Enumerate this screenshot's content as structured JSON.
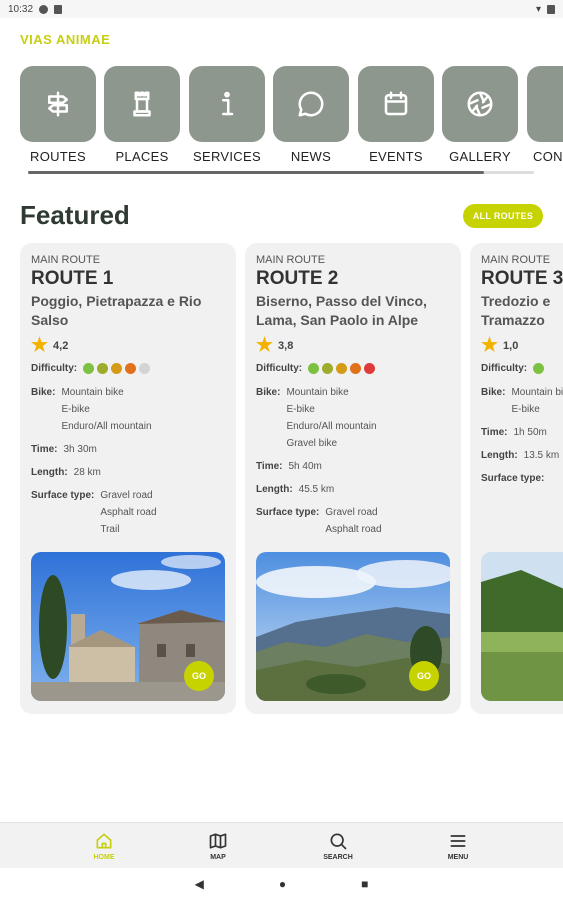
{
  "status_bar": {
    "time": "10:32"
  },
  "app": {
    "title": "VIAS ANIMAE"
  },
  "categories": [
    {
      "label": "ROUTES",
      "icon": "signpost-icon"
    },
    {
      "label": "PLACES",
      "icon": "tower-icon"
    },
    {
      "label": "SERVICES",
      "icon": "info-icon"
    },
    {
      "label": "NEWS",
      "icon": "chat-bubble-icon"
    },
    {
      "label": "EVENTS",
      "icon": "calendar-icon"
    },
    {
      "label": "GALLERY",
      "icon": "camera-aperture-icon"
    },
    {
      "label": "CON",
      "icon": "tile-icon"
    }
  ],
  "featured": {
    "heading": "Featured",
    "all_routes_label": "ALL ROUTES"
  },
  "labels": {
    "difficulty": "Difficulty:",
    "bike": "Bike:",
    "time": "Time:",
    "length": "Length:",
    "surface": "Surface type:",
    "go": "GO"
  },
  "cards": [
    {
      "kind": "MAIN ROUTE",
      "title": "ROUTE 1",
      "subtitle_lines": [
        "Poggio, Pietrapazza e Rio",
        "Salso"
      ],
      "rating": "4,2",
      "difficulty_colors": [
        "#7dc142",
        "#9dac2a",
        "#d59a16",
        "#e2711b",
        "#d4d4d4"
      ],
      "bike": [
        "Mountain bike",
        "E-bike",
        "Enduro/All mountain"
      ],
      "time": "3h 30m",
      "length": "28 km",
      "surface": [
        "Gravel road",
        "Asphalt road",
        "Trail"
      ]
    },
    {
      "kind": "MAIN ROUTE",
      "title": "ROUTE 2",
      "subtitle_lines": [
        "Biserno, Passo del Vinco,",
        "Lama, San Paolo in Alpe"
      ],
      "rating": "3,8",
      "difficulty_colors": [
        "#7dc142",
        "#9dac2a",
        "#d59a16",
        "#e2711b",
        "#e03b3b"
      ],
      "bike": [
        "Mountain bike",
        "E-bike",
        "Enduro/All mountain",
        "Gravel bike"
      ],
      "time": "5h 40m",
      "length": "45.5 km",
      "surface": [
        "Gravel road",
        "Asphalt road"
      ]
    },
    {
      "kind": "MAIN ROUTE",
      "title": "ROUTE 3",
      "subtitle_lines": [
        "Tredozio e",
        "Tramazzo"
      ],
      "rating": "1,0",
      "difficulty_colors": [
        "#7dc142"
      ],
      "bike": [
        "Mountain bike",
        "E-bike"
      ],
      "time": "1h 50m",
      "length": "13.5 km",
      "surface": [
        ""
      ]
    }
  ],
  "bottom_nav": [
    {
      "label": "HOME",
      "icon": "home-icon",
      "active": true
    },
    {
      "label": "MAP",
      "icon": "map-icon",
      "active": false
    },
    {
      "label": "SEARCH",
      "icon": "search-icon",
      "active": false
    },
    {
      "label": "MENU",
      "icon": "menu-icon",
      "active": false
    }
  ]
}
